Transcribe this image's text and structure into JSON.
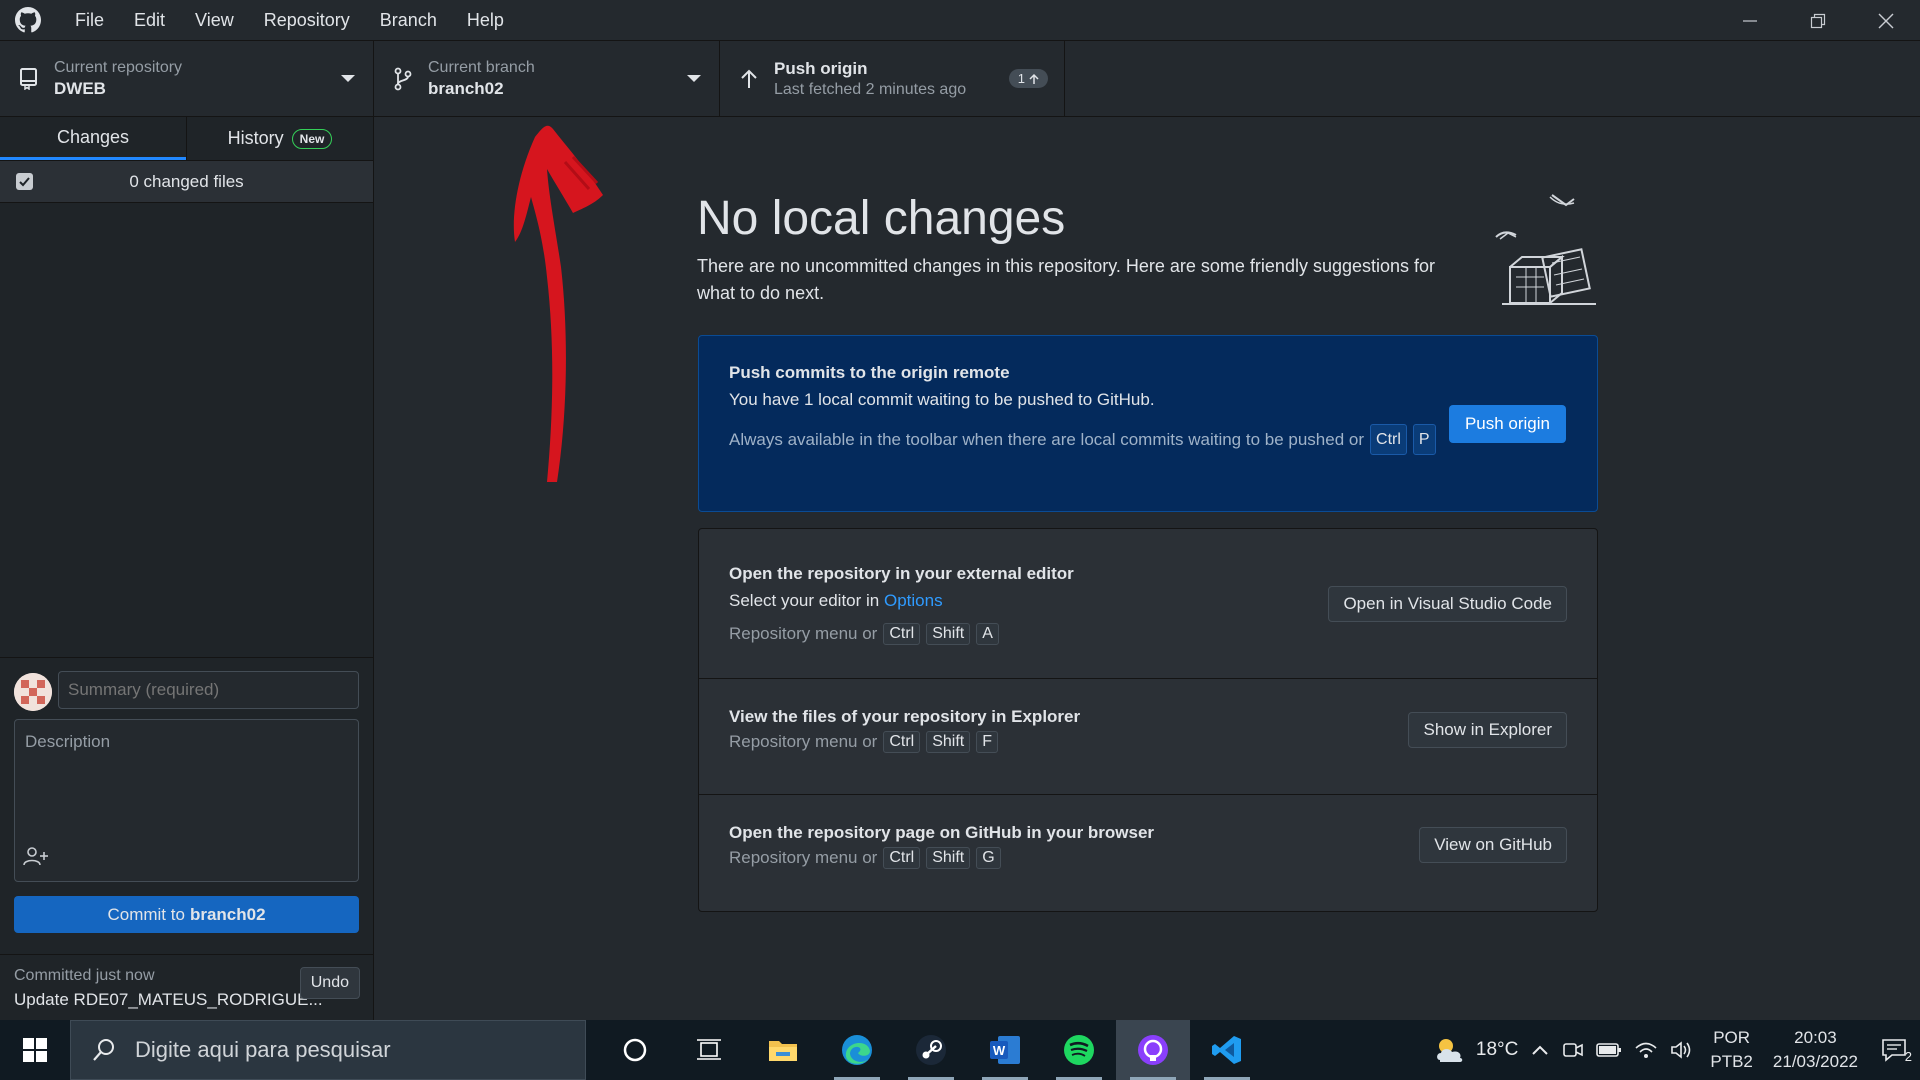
{
  "menu": [
    "File",
    "Edit",
    "View",
    "Repository",
    "Branch",
    "Help"
  ],
  "toolbar": {
    "repo_label": "Current repository",
    "repo_value": "DWEB",
    "branch_label": "Current branch",
    "branch_value": "branch02",
    "push_title": "Push origin",
    "push_subtitle": "Last fetched 2 minutes ago",
    "push_badge": "1"
  },
  "sidebar": {
    "tab_changes": "Changes",
    "tab_history": "History",
    "history_badge": "New",
    "changed_files": "0 changed files",
    "summary_placeholder": "Summary (required)",
    "description_placeholder": "Description",
    "commit_prefix": "Commit to",
    "commit_branch": "branch02",
    "last_commit_time": "Committed just now",
    "last_commit_msg": "Update RDE07_MATEUS_RODRIGUE...",
    "undo_label": "Undo"
  },
  "main": {
    "heading": "No local changes",
    "subtext": "There are no uncommitted changes in this repository. Here are some friendly suggestions for what to do next.",
    "push_card": {
      "title": "Push commits to the origin remote",
      "desc": "You have 1 local commit waiting to be pushed to GitHub.",
      "hint": "Always available in the toolbar when there are local commits waiting to be pushed or",
      "keys": [
        "Ctrl",
        "P"
      ],
      "button": "Push origin"
    },
    "editor": {
      "title": "Open the repository in your external editor",
      "desc_prefix": "Select your editor in",
      "desc_link": "Options",
      "hint": "Repository menu or",
      "keys": [
        "Ctrl",
        "Shift",
        "A"
      ],
      "button": "Open in Visual Studio Code"
    },
    "explorer": {
      "title": "View the files of your repository in Explorer",
      "hint": "Repository menu or",
      "keys": [
        "Ctrl",
        "Shift",
        "F"
      ],
      "button": "Show in Explorer"
    },
    "github": {
      "title": "Open the repository page on GitHub in your browser",
      "hint": "Repository menu or",
      "keys": [
        "Ctrl",
        "Shift",
        "G"
      ],
      "button": "View on GitHub"
    }
  },
  "taskbar": {
    "search_placeholder": "Digite aqui para pesquisar",
    "weather": "18°C",
    "lang_line1": "POR",
    "lang_line2": "PTB2",
    "time": "20:03",
    "date": "21/03/2022",
    "notification_count": "2"
  },
  "colors": {
    "accent": "#1c7ce0",
    "push_card_bg": "#042a5c",
    "annotation": "#e0141e"
  }
}
